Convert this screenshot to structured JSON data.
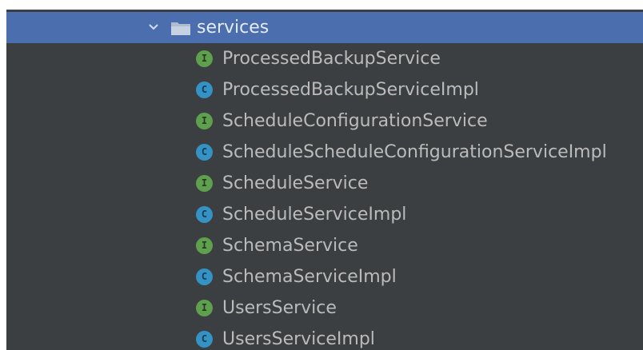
{
  "tree": {
    "folder": {
      "label": "services",
      "expanded": true,
      "icon": "folder-icon",
      "chevron": "chevron-down-icon"
    },
    "items": [
      {
        "label": "ProcessedBackupService",
        "kind": "interface",
        "badge": "I"
      },
      {
        "label": "ProcessedBackupServiceImpl",
        "kind": "class",
        "badge": "C"
      },
      {
        "label": "ScheduleConfigurationService",
        "kind": "interface",
        "badge": "I"
      },
      {
        "label": "ScheduleScheduleConfigurationServiceImpl",
        "kind": "class",
        "badge": "C"
      },
      {
        "label": "ScheduleService",
        "kind": "interface",
        "badge": "I"
      },
      {
        "label": "ScheduleServiceImpl",
        "kind": "class",
        "badge": "C"
      },
      {
        "label": "SchemaService",
        "kind": "interface",
        "badge": "I"
      },
      {
        "label": "SchemaServiceImpl",
        "kind": "class",
        "badge": "C"
      },
      {
        "label": "UsersService",
        "kind": "interface",
        "badge": "I"
      },
      {
        "label": "UsersServiceImpl",
        "kind": "class",
        "badge": "C"
      }
    ]
  },
  "colors": {
    "panel_background": "#3c3f41",
    "selection": "#4b6eaf",
    "interface_badge": "#5fa04e",
    "class_badge": "#3592c4",
    "text": "#bbbbbb"
  }
}
